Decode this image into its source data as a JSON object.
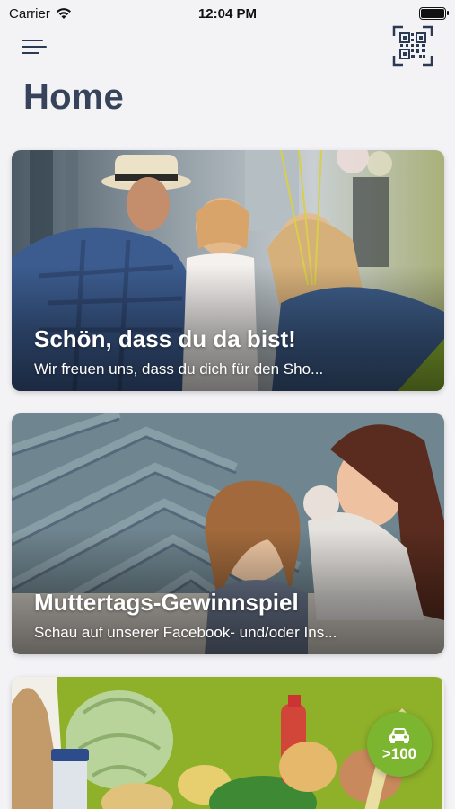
{
  "status_bar": {
    "carrier": "Carrier",
    "time": "12:04 PM"
  },
  "header": {
    "menu_icon": "hamburger-menu-icon",
    "qr_icon": "qr-code-scan-icon",
    "title": "Home"
  },
  "cards": [
    {
      "title": "Schön, dass du da bist!",
      "subtitle": "Wir freuen uns, dass du dich für den Sho..."
    },
    {
      "title": "Muttertags-Gewinnspiel",
      "subtitle": "Schau auf unserer Facebook- und/oder Ins..."
    },
    {
      "title": "",
      "subtitle": ""
    }
  ],
  "fab": {
    "icon": "car-icon",
    "label": ">100"
  },
  "colors": {
    "background": "#f3f3f6",
    "title": "#37435a",
    "accent_green": "#7cb630"
  }
}
